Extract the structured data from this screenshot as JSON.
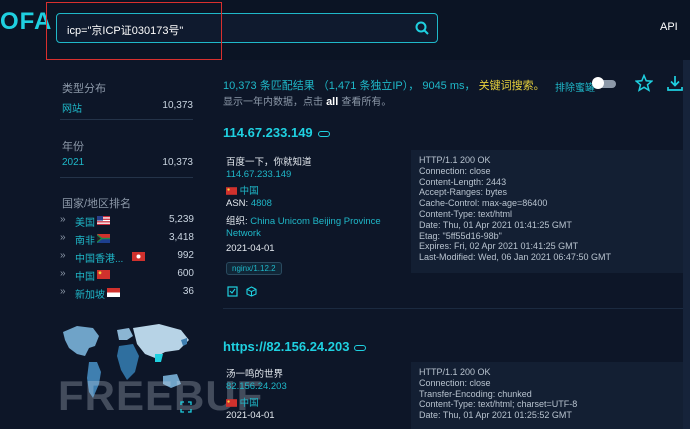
{
  "app": {
    "logo_text": "OFA",
    "api_label": "API"
  },
  "search": {
    "query": "icp=\"京ICP证030173号\""
  },
  "sidebar": {
    "type_heading": "类型分布",
    "type_items": [
      {
        "label": "网站",
        "count": "10,373"
      }
    ],
    "year_heading": "年份",
    "year_items": [
      {
        "label": "2021",
        "count": "10,373"
      }
    ],
    "country_heading": "国家/地区排名",
    "countries": [
      {
        "name": "美国",
        "count": "5,239"
      },
      {
        "name": "南非",
        "count": "3,418"
      },
      {
        "name": "中国香港...",
        "count": "992"
      },
      {
        "name": "中国",
        "count": "600"
      },
      {
        "name": "新加坡",
        "count": "36"
      }
    ]
  },
  "summary": {
    "matches": "10,373",
    "matches_suffix": "条匹配结果",
    "unique_ip": "（1,471 条独立IP），",
    "time": "9045 ms，",
    "keyword_search": "关键词搜索。",
    "sub_line_prefix": "显示一年内数据，点击",
    "all_link": "all",
    "sub_line_suffix": "查看所有。",
    "exclude_label": "排除蜜罐"
  },
  "results": [
    {
      "title": "114.67.233.149",
      "page_title": "百度一下，你就知道",
      "ip": "114.67.233.149",
      "country": "中国",
      "asn_label": "ASN:",
      "asn": "4808",
      "org_label": "组织:",
      "org_line1": "China Unicom Beijing Province",
      "org_line2": "Network",
      "date": "2021-04-01",
      "server_tag": "nginx/1.12.2",
      "headers": [
        "HTTP/1.1 200 OK",
        "Connection: close",
        "Content-Length: 2443",
        "Accept-Ranges: bytes",
        "Cache-Control: max-age=86400",
        "Content-Type: text/html",
        "Date: Thu, 01 Apr 2021 01:41:25 GMT",
        "Etag: \"5ff55d16-98b\"",
        "Expires: Fri, 02 Apr 2021 01:41:25 GMT",
        "Last-Modified: Wed, 06 Jan 2021 06:47:50 GMT"
      ]
    },
    {
      "title": "https://82.156.24.203",
      "page_title": "汤一鸣的世界",
      "ip": "82.156.24.203",
      "country": "中国",
      "date": "2021-04-01",
      "headers": [
        "HTTP/1.1 200 OK",
        "Connection: close",
        "Transfer-Encoding: chunked",
        "Content-Type: text/html; charset=UTF-8",
        "Date: Thu, 01 Apr 2021 01:25:52 GMT"
      ]
    }
  ],
  "watermark": "FREEBUF",
  "colors": {
    "accent": "#1fd0e0",
    "highlight": "#d9302e",
    "keyword": "#e8d13c",
    "background": "#0d1628"
  }
}
